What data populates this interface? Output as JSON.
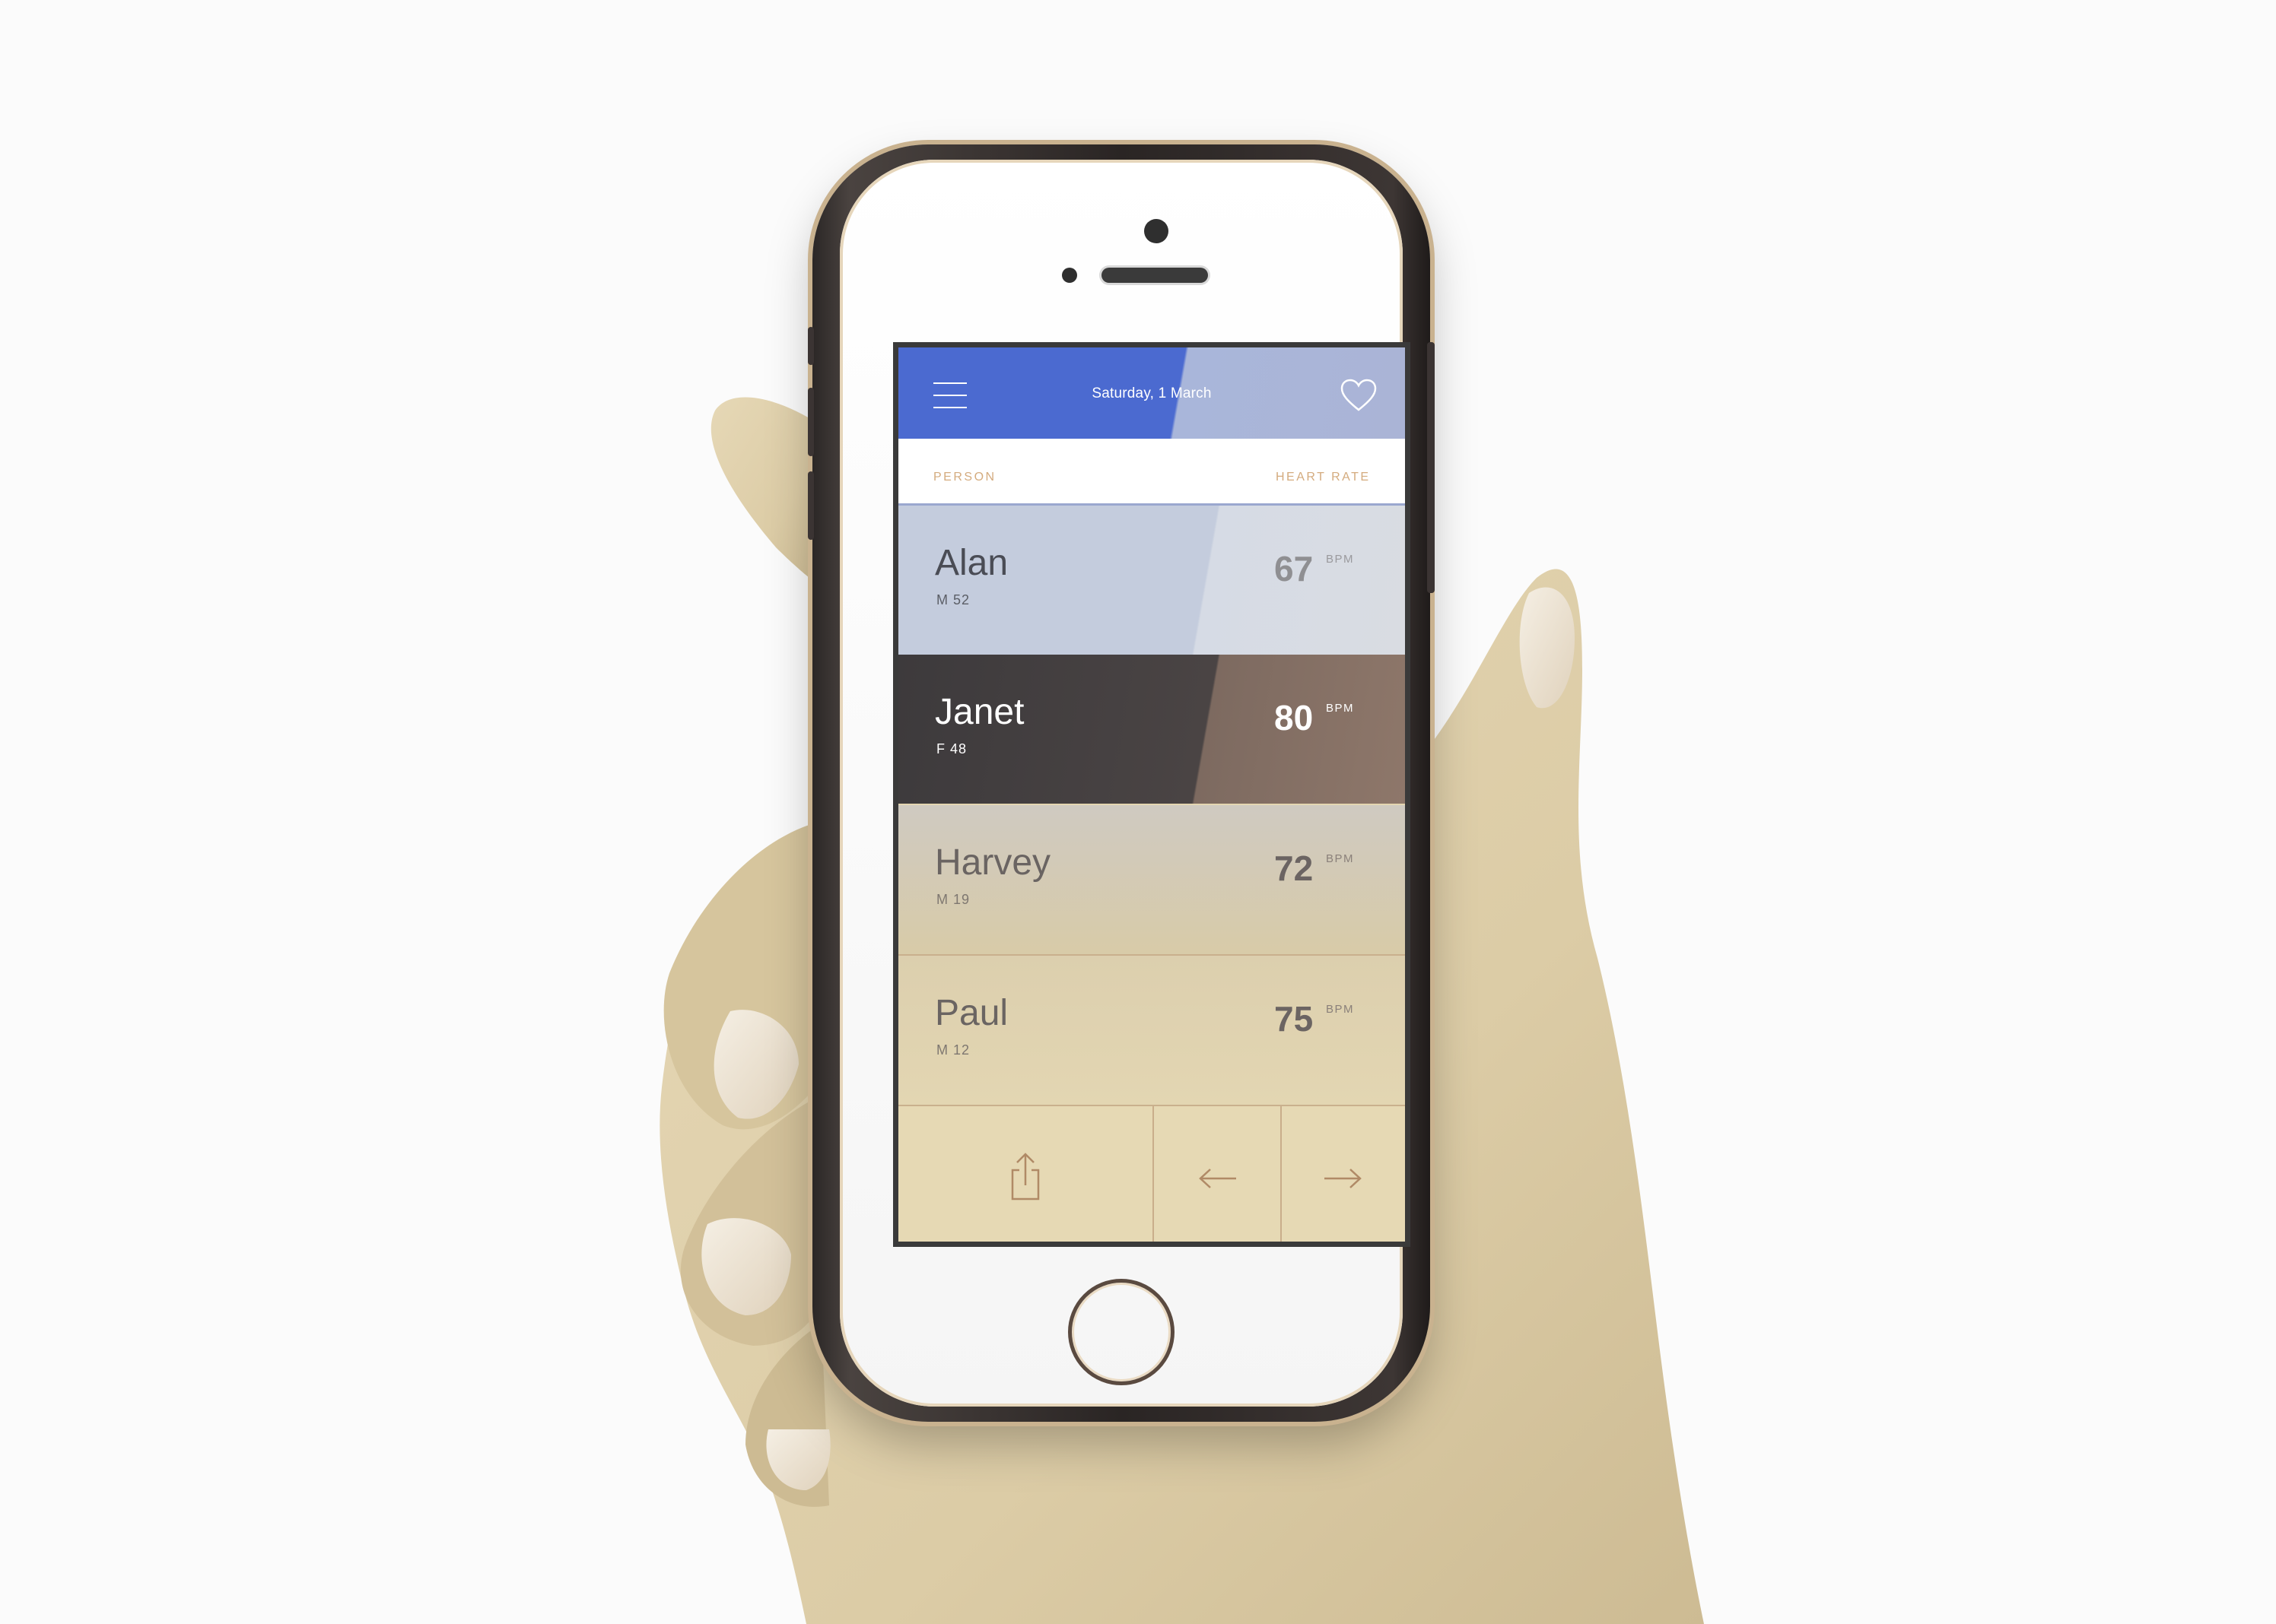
{
  "header": {
    "date": "Saturday, 1 March",
    "menu_icon": "hamburger-menu-icon",
    "favorite_icon": "heart-outline-icon"
  },
  "columns": {
    "person": "PERSON",
    "heart_rate": "HEART RATE"
  },
  "people": [
    {
      "name": "Alan",
      "meta": "M 52",
      "bpm": "67",
      "unit": "BPM"
    },
    {
      "name": "Janet",
      "meta": "F 48",
      "bpm": "80",
      "unit": "BPM"
    },
    {
      "name": "Harvey",
      "meta": "M 19",
      "bpm": "72",
      "unit": "BPM"
    },
    {
      "name": "Paul",
      "meta": "M 12",
      "bpm": "75",
      "unit": "BPM"
    }
  ],
  "toolbar": {
    "share_icon": "share-icon",
    "back_icon": "arrow-left-icon",
    "forward_icon": "arrow-right-icon"
  },
  "colors": {
    "header_blue": "#4b6ad0",
    "accent_gold": "#d4ab7e",
    "selected_row": "#3d3a3c"
  }
}
